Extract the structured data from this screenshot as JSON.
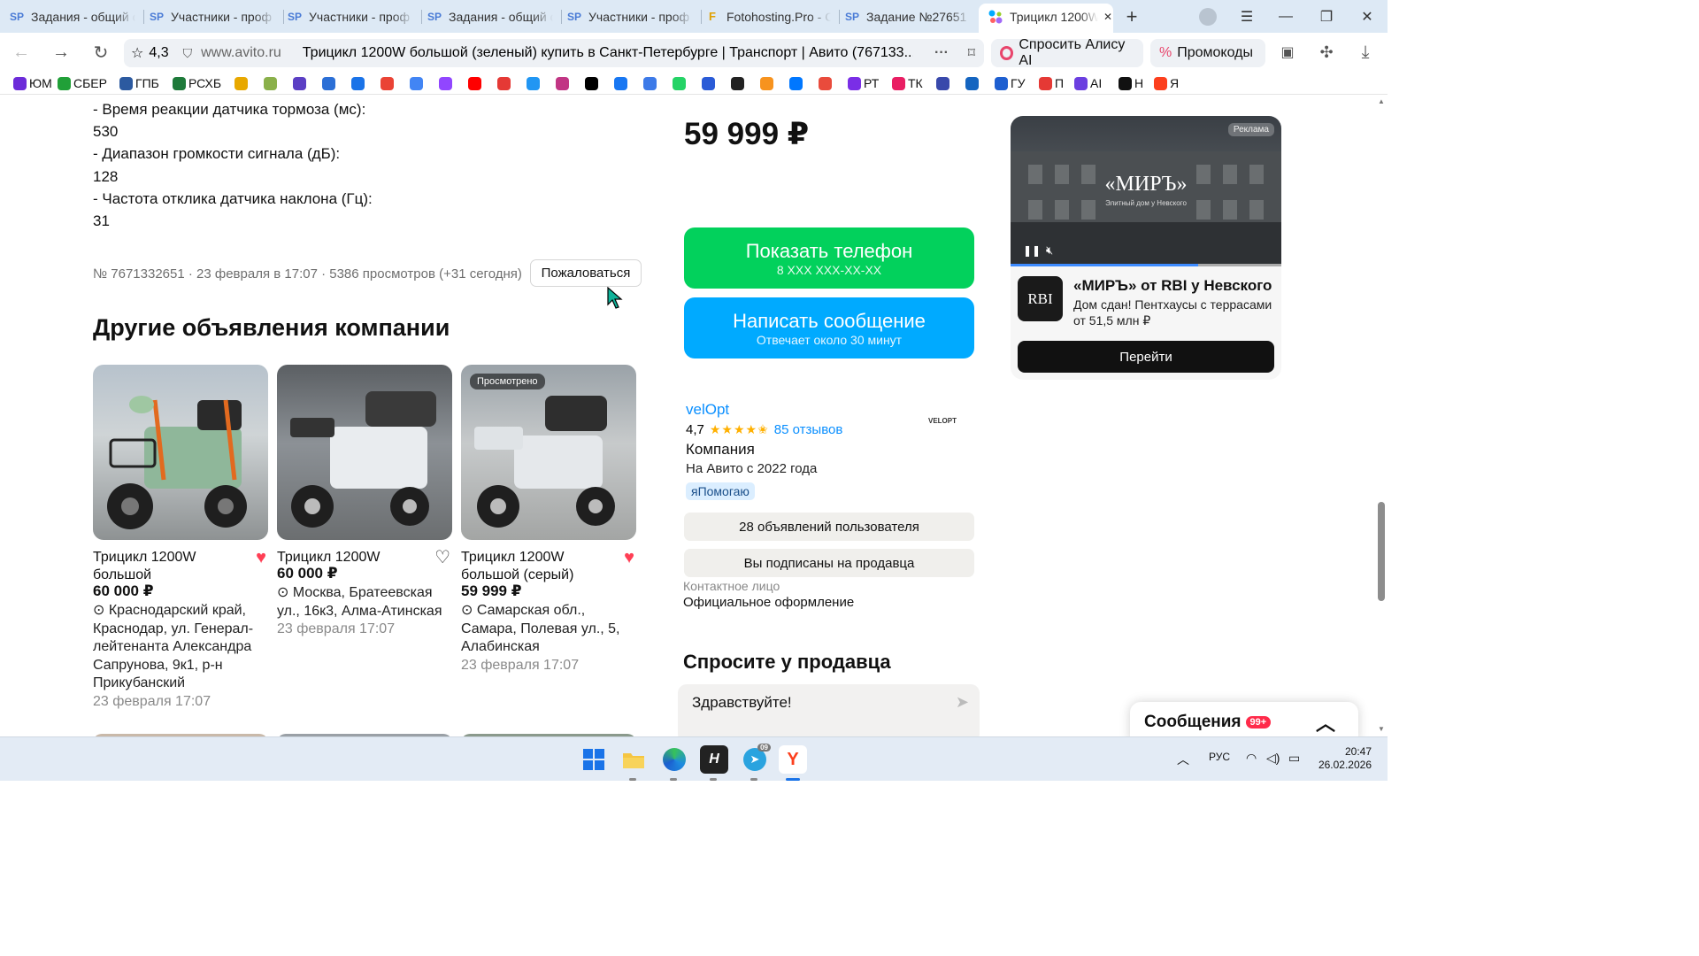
{
  "browser": {
    "tabs": [
      {
        "label": "Задания - общий с",
        "icon": "sp-icon"
      },
      {
        "label": "Участники - проф",
        "icon": "sp-icon"
      },
      {
        "label": "Участники - проф",
        "icon": "sp-icon"
      },
      {
        "label": "Задания - общий с",
        "icon": "sp-icon"
      },
      {
        "label": "Участники - проф",
        "icon": "sp-icon"
      },
      {
        "label": "Fotohosting.Pro - С",
        "icon": "f-icon"
      },
      {
        "label": "Задание №27651",
        "icon": "sp-icon"
      },
      {
        "label": "Трицикл 1200W",
        "icon": "avito-icon",
        "active": true
      }
    ],
    "rating": "4,3",
    "domain": "www.avito.ru",
    "page_title": "Трицикл 1200W большой (зеленый) купить в Санкт-Петербурге | Транспорт | Авито (767133...",
    "alice": "Спросить Алису AI",
    "promo": "Промокоды",
    "bookmarks": [
      {
        "label": "ЮМ",
        "color": "#6c2bd9"
      },
      {
        "label": "СБЕР",
        "color": "#21a038"
      },
      {
        "label": "ГПБ",
        "color": "#2c5aa0"
      },
      {
        "label": "РСХБ",
        "color": "#1e7a3a"
      },
      {
        "label": "",
        "color": "#e8a800"
      },
      {
        "label": "",
        "color": "#8ab04a"
      },
      {
        "label": "",
        "color": "#5b3fc4"
      },
      {
        "label": "",
        "color": "#2b6fd6"
      },
      {
        "label": "",
        "color": "#1a73e8"
      },
      {
        "label": "",
        "color": "#ea4335"
      },
      {
        "label": "",
        "color": "#4285f4"
      },
      {
        "label": "",
        "color": "#9146ff"
      },
      {
        "label": "",
        "color": "#ff0000"
      },
      {
        "label": "",
        "color": "#e53935"
      },
      {
        "label": "",
        "color": "#2196f3"
      },
      {
        "label": "",
        "color": "#c13584"
      },
      {
        "label": "",
        "color": "#000000"
      },
      {
        "label": "",
        "color": "#1877f2"
      },
      {
        "label": "",
        "color": "#3d7ae8"
      },
      {
        "label": "",
        "color": "#25d366"
      },
      {
        "label": "",
        "color": "#2a5bd7"
      },
      {
        "label": "",
        "color": "#222222"
      },
      {
        "label": "",
        "color": "#f7931e"
      },
      {
        "label": "",
        "color": "#0077ff"
      },
      {
        "label": "",
        "color": "#e94b3c"
      },
      {
        "label": "РТ",
        "color": "#7a2ee6"
      },
      {
        "label": "ТК",
        "color": "#e91e63"
      },
      {
        "label": "",
        "color": "#3949ab"
      },
      {
        "label": "",
        "color": "#1565c0"
      },
      {
        "label": "ГУ",
        "color": "#1e5fd0"
      },
      {
        "label": "П",
        "color": "#e53935"
      },
      {
        "label": "AI",
        "color": "#6b3fe0"
      },
      {
        "label": "Н",
        "color": "#111111"
      },
      {
        "label": "Я",
        "color": "#fc3f1d"
      }
    ]
  },
  "specs": [
    "- Время реакции датчика тормоза (мс):",
    "530",
    "- Диапазон громкости сигнала (дБ):",
    "128",
    "- Частота отклика датчика наклона (Гц):",
    "31"
  ],
  "listing_meta": "№ 7671332651 · 23 февраля в 17:07 · 5386 просмотров (+31 сегодня)",
  "complain_label": "Пожаловаться",
  "other_listings_title": "Другие объявления компании",
  "cards": [
    {
      "title": "Трицикл 1200W большой",
      "price": "60 000 ₽",
      "address": "Краснодарский край, Краснодар, ул. Генерал-лейтенанта Александра Сапрунова, 9к1, р-н Прикубанский",
      "date": "23 февраля 17:07",
      "favorited": true,
      "seen": ""
    },
    {
      "title": "Трицикл 1200W",
      "price": "60 000 ₽",
      "address": "Москва, Братеевская ул., 16к3, Алма-Атинская",
      "date": "23 февраля 17:07",
      "favorited": false,
      "seen": ""
    },
    {
      "title": "Трицикл 1200W большой (серый)",
      "price": "59 999 ₽",
      "address": "Самарская обл., Самара, Полевая ул., 5, Алабинская",
      "date": "23 февраля 17:07",
      "favorited": true,
      "seen": "Просмотрено"
    }
  ],
  "price": "59 999 ₽",
  "phone_button": {
    "label": "Показать телефон",
    "sub": "8 XXX XXX-XX-XX",
    "color": "#02d15c"
  },
  "message_button": {
    "label": "Написать сообщение",
    "sub": "Отвечает около 30 минут",
    "color": "#00aaff"
  },
  "seller": {
    "name": "velOpt",
    "rating": "4,7",
    "reviews": "85 отзывов",
    "type": "Компания",
    "since": "На Авито с 2022 года",
    "badge": "яПомогаю",
    "logo_text": "VELOPT",
    "listings": "28 объявлений пользователя",
    "subscribed": "Вы подписаны на продавца",
    "contact_label": "Контактное лицо",
    "contact_value": "Официальное оформление"
  },
  "ask_title": "Спросите у продавца",
  "ask_placeholder": "Здравствуйте!",
  "ad": {
    "tag": "Реклама",
    "brand": "«МИРЪ»",
    "brand_sub": "Элитный дом у Невского",
    "logo": "RBI",
    "title": "«МИРЪ» от RBI у Невского",
    "text": "Дом сдан! Пентхаусы с террасами от 51,5 млн ₽",
    "go": "Перейти"
  },
  "messages": {
    "label": "Сообщения",
    "badge": "99+"
  },
  "taskbar": {
    "lang": "РУС",
    "time": "20:47",
    "date": "26.02.2026",
    "telegram_badge": "09"
  }
}
